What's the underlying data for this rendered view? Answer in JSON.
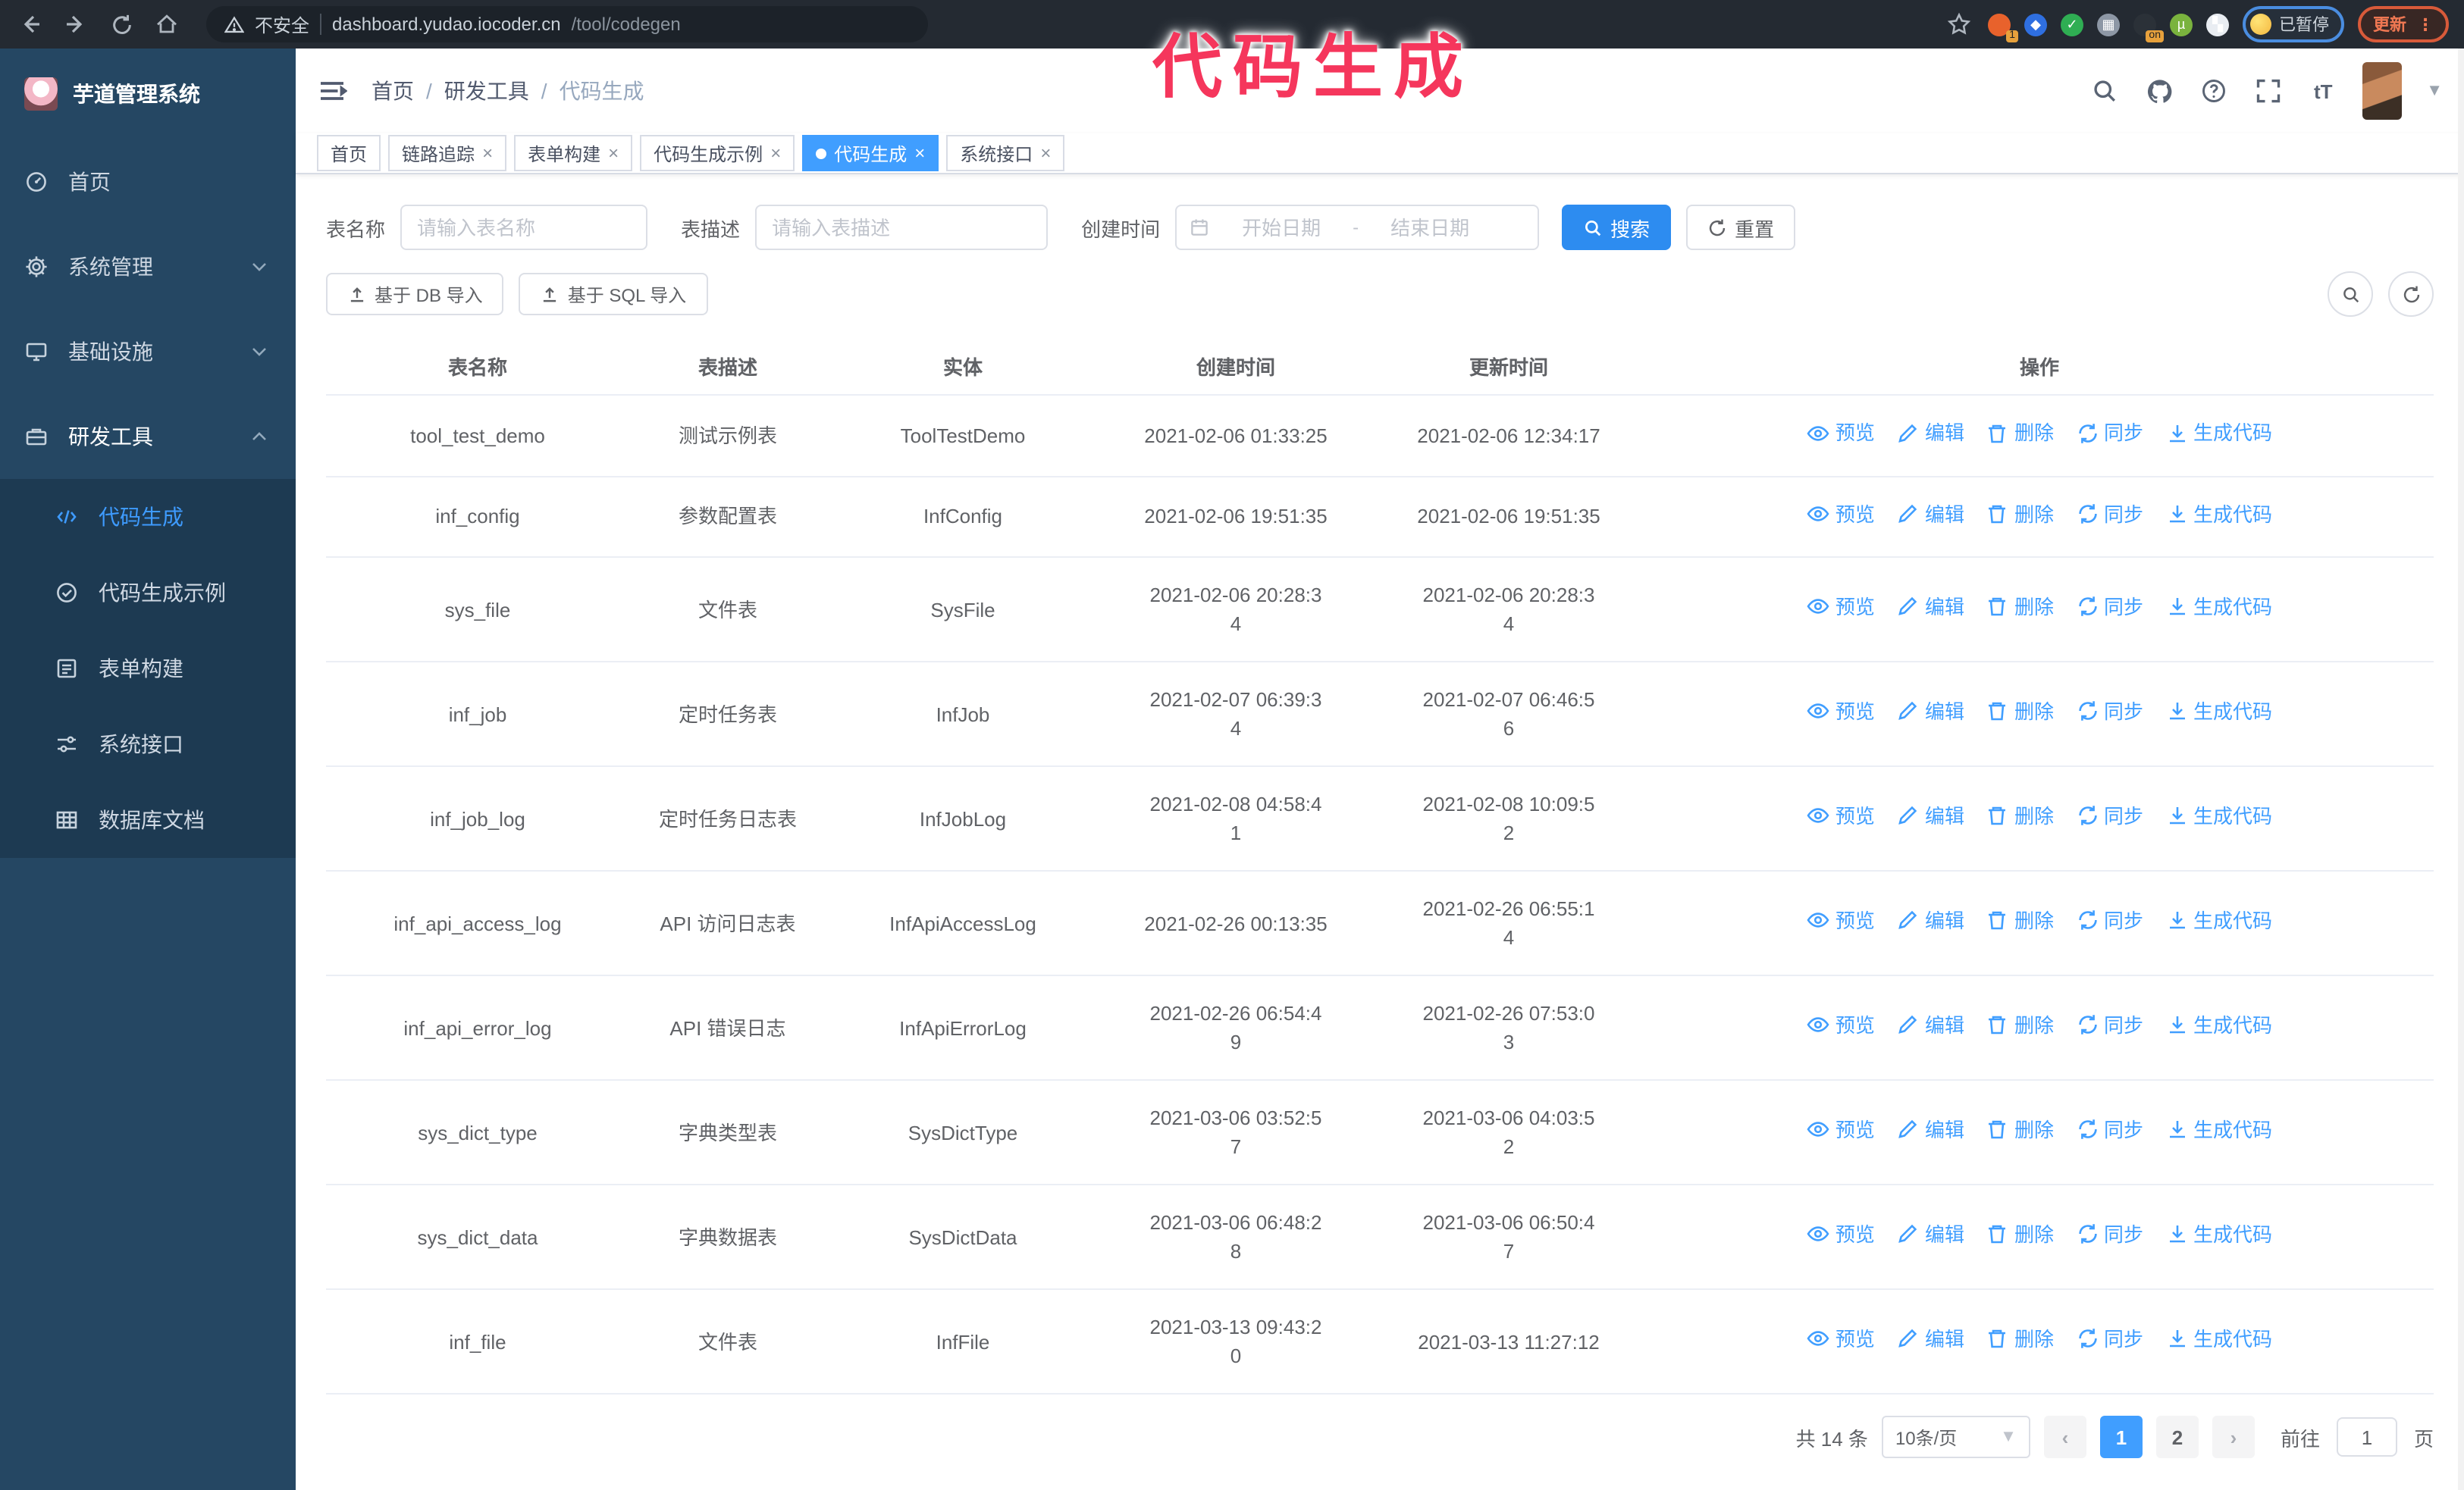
{
  "colors": {
    "accent": "#409eff",
    "primary_button": "#2d8cf0",
    "sidebar_bg": "#254763",
    "submenu_bg": "#1d3a52",
    "chrome_bg": "#242a32",
    "annotation": "#f5365c",
    "border": "#ebeef5"
  },
  "browser": {
    "url_warning": "不安全",
    "url_host": "dashboard.yudao.iocoder.cn",
    "url_path": "/tool/codegen",
    "paused_badge": "已暂停",
    "update_button": "更新",
    "extension_icons": [
      {
        "color": "#e8622c",
        "badge": "1"
      },
      {
        "color": "#2f6fe0",
        "glyph": "◆"
      },
      {
        "color": "#2fae53",
        "glyph": "✓"
      },
      {
        "color": "#8d97a5",
        "glyph": "▦"
      },
      {
        "color": "#2b3138",
        "badge": "on"
      },
      {
        "color": "#7ab33e",
        "glyph": "µ"
      },
      {
        "color": "#e9edf2",
        "glyph": "▚"
      }
    ]
  },
  "annotation": {
    "text": "代码生成"
  },
  "sidebar": {
    "logo_title": "芋道管理系统",
    "items": [
      {
        "label": "首页",
        "icon": "dashboard"
      },
      {
        "label": "系统管理",
        "icon": "gear",
        "expandable": true
      },
      {
        "label": "基础设施",
        "icon": "monitor",
        "expandable": true
      },
      {
        "label": "研发工具",
        "icon": "toolbox",
        "expanded": true
      }
    ],
    "submenu": [
      {
        "label": "代码生成",
        "icon": "code",
        "active": true
      },
      {
        "label": "代码生成示例",
        "icon": "example"
      },
      {
        "label": "表单构建",
        "icon": "form"
      },
      {
        "label": "系统接口",
        "icon": "api"
      },
      {
        "label": "数据库文档",
        "icon": "database"
      }
    ]
  },
  "header": {
    "breadcrumb": [
      "首页",
      "研发工具",
      "代码生成"
    ]
  },
  "tabs": [
    {
      "label": "首页",
      "closable": false,
      "active": false
    },
    {
      "label": "链路追踪",
      "closable": true,
      "active": false
    },
    {
      "label": "表单构建",
      "closable": true,
      "active": false
    },
    {
      "label": "代码生成示例",
      "closable": true,
      "active": false
    },
    {
      "label": "代码生成",
      "closable": true,
      "active": true
    },
    {
      "label": "系统接口",
      "closable": true,
      "active": false
    }
  ],
  "filters": {
    "name_label": "表名称",
    "name_placeholder": "请输入表名称",
    "desc_label": "表描述",
    "desc_placeholder": "请输入表描述",
    "time_label": "创建时间",
    "start_placeholder": "开始日期",
    "range_separator": "-",
    "end_placeholder": "结束日期",
    "search_button": "搜索",
    "reset_button": "重置"
  },
  "toolbar": {
    "import_db": "基于 DB 导入",
    "import_sql": "基于 SQL 导入"
  },
  "table": {
    "columns": [
      "表名称",
      "表描述",
      "实体",
      "创建时间",
      "更新时间",
      "操作"
    ],
    "actions": [
      "预览",
      "编辑",
      "删除",
      "同步",
      "生成代码"
    ],
    "rows": [
      {
        "name": "tool_test_demo",
        "desc": "测试示例表",
        "entity": "ToolTestDemo",
        "created": "2021-02-06 01:33:25",
        "updated": "2021-02-06 12:34:17"
      },
      {
        "name": "inf_config",
        "desc": "参数配置表",
        "entity": "InfConfig",
        "created": "2021-02-06 19:51:35",
        "updated": "2021-02-06 19:51:35"
      },
      {
        "name": "sys_file",
        "desc": "文件表",
        "entity": "SysFile",
        "created": "2021-02-06 20:28:3\n4",
        "updated": "2021-02-06 20:28:3\n4"
      },
      {
        "name": "inf_job",
        "desc": "定时任务表",
        "entity": "InfJob",
        "created": "2021-02-07 06:39:3\n4",
        "updated": "2021-02-07 06:46:5\n6"
      },
      {
        "name": "inf_job_log",
        "desc": "定时任务日志表",
        "entity": "InfJobLog",
        "created": "2021-02-08 04:58:4\n1",
        "updated": "2021-02-08 10:09:5\n2"
      },
      {
        "name": "inf_api_access_log",
        "desc": "API 访问日志表",
        "entity": "InfApiAccessLog",
        "created": "2021-02-26 00:13:35",
        "updated": "2021-02-26 06:55:1\n4"
      },
      {
        "name": "inf_api_error_log",
        "desc": "API 错误日志",
        "entity": "InfApiErrorLog",
        "created": "2021-02-26 06:54:4\n9",
        "updated": "2021-02-26 07:53:0\n3"
      },
      {
        "name": "sys_dict_type",
        "desc": "字典类型表",
        "entity": "SysDictType",
        "created": "2021-03-06 03:52:5\n7",
        "updated": "2021-03-06 04:03:5\n2"
      },
      {
        "name": "sys_dict_data",
        "desc": "字典数据表",
        "entity": "SysDictData",
        "created": "2021-03-06 06:48:2\n8",
        "updated": "2021-03-06 06:50:4\n7"
      },
      {
        "name": "inf_file",
        "desc": "文件表",
        "entity": "InfFile",
        "created": "2021-03-13 09:43:2\n0",
        "updated": "2021-03-13 11:27:12"
      }
    ]
  },
  "pagination": {
    "total": "共 14 条",
    "page_size": "10条/页",
    "pages": [
      "1",
      "2"
    ],
    "active_page": "1",
    "goto_label": "前往",
    "goto_value": "1",
    "goto_suffix": "页"
  }
}
